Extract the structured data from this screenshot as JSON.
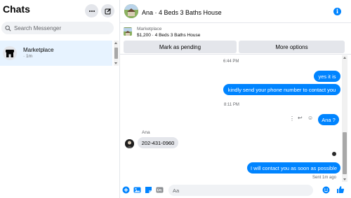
{
  "sidebar": {
    "title": "Chats",
    "more_icon": "more-icon",
    "compose_icon": "compose-icon",
    "search_placeholder": "Search Messenger",
    "conversations": [
      {
        "name": "Marketplace",
        "time": "· 1m",
        "icon": "store-icon"
      }
    ]
  },
  "header": {
    "title": "Ana · 4 Beds 3 Baths House",
    "info_icon": "info-icon"
  },
  "listing": {
    "label": "Marketplace",
    "description": "$1,200 · 4 Beds 3 Baths House",
    "buttons": [
      "Mark as pending",
      "More options"
    ]
  },
  "messages": {
    "ts1": "6:44 PM",
    "msg_yes": "yes it is",
    "msg_phone": "kindly send your phone number to contact you",
    "ts2": "8:11 PM",
    "msg_ana": "Ana ?",
    "sender_name": "Ana",
    "msg_number": "202-431-0960",
    "msg_contact": "I will contact you as soon as possible",
    "sent_status": "Sent 1m ago"
  },
  "composer": {
    "placeholder": "Aa"
  },
  "colors": {
    "accent": "#0084ff",
    "bubble_in": "#e4e6eb",
    "selected_row": "#e7f3ff"
  }
}
